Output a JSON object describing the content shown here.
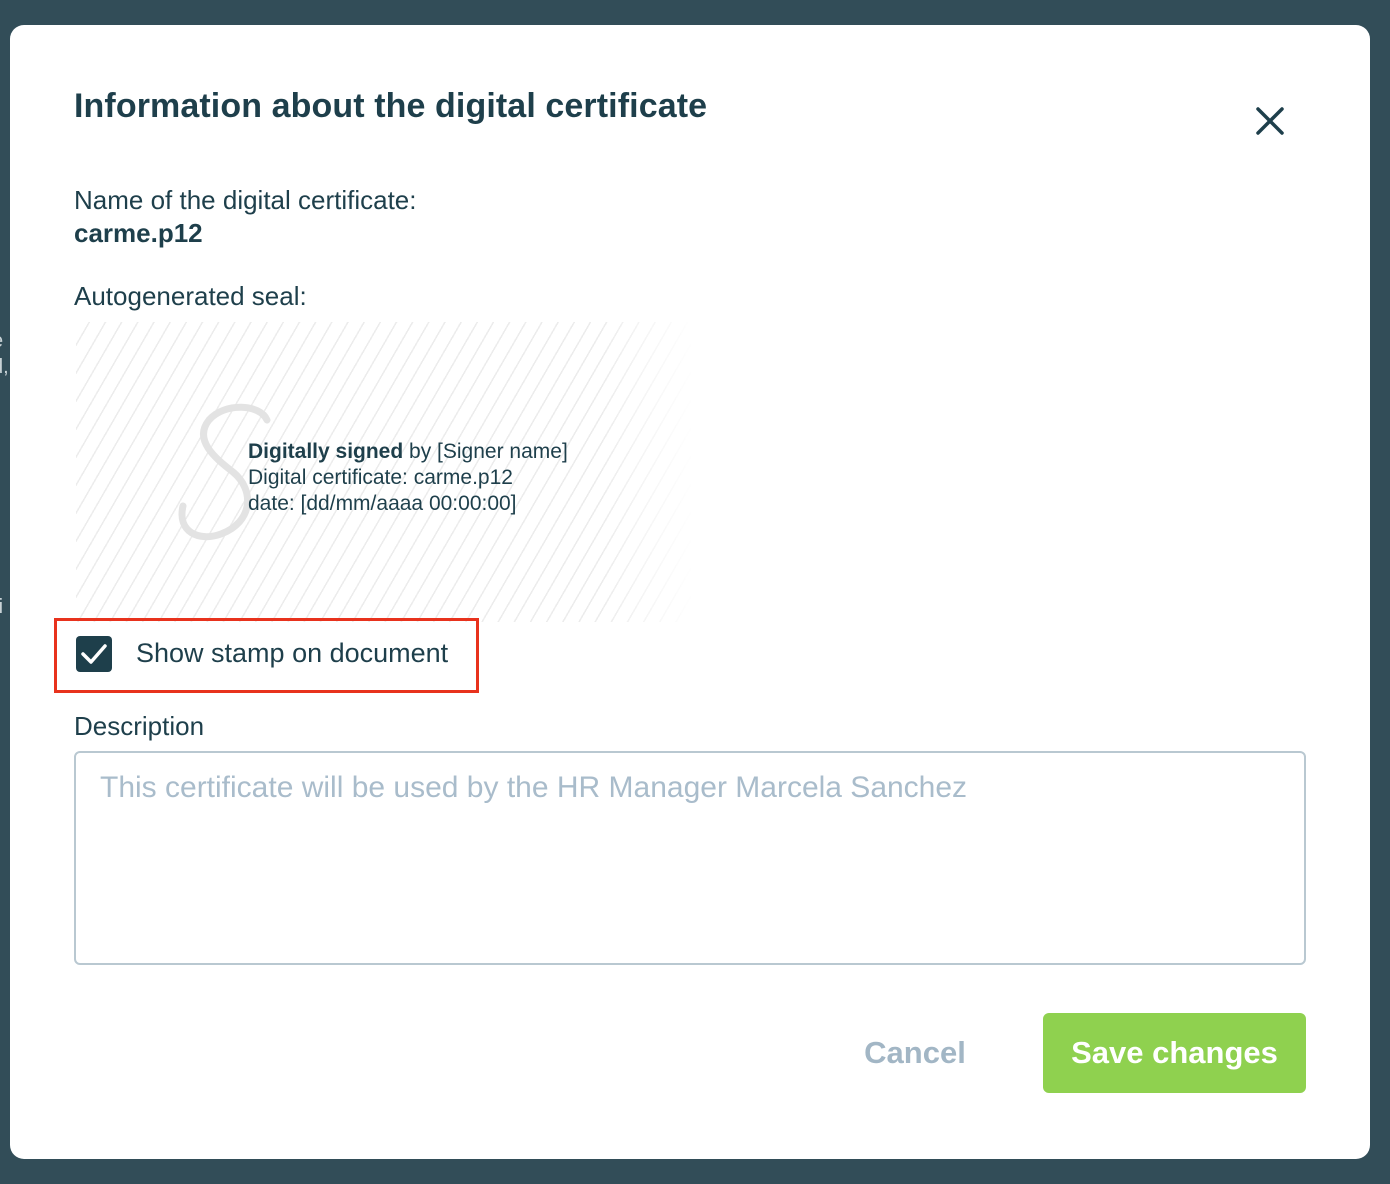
{
  "modal": {
    "title": "Information about the digital certificate",
    "certificate_label": "Name of the digital certificate:",
    "certificate_name": "carme.p12",
    "seal_label": "Autogenerated seal:",
    "seal": {
      "signed_bold": "Digitally signed",
      "signed_rest": " by [Signer name]",
      "certificate_line": "Digital certificate: carme.p12",
      "date_line": "date: [dd/mm/aaaa 00:00:00]"
    },
    "show_stamp": {
      "label": "Show stamp on document",
      "checked": true
    },
    "description": {
      "label": "Description",
      "placeholder": "This certificate will be used by the HR Manager Marcela Sanchez",
      "value": ""
    },
    "buttons": {
      "cancel": "Cancel",
      "save": "Save changes"
    }
  },
  "background_fragments": [
    ",",
    "e",
    "d,",
    "ri"
  ],
  "colors": {
    "backdrop": "#324d58",
    "text_primary": "#1e3f4b",
    "save_button": "#8fd14f",
    "cancel_text": "#a2b6c5",
    "highlight": "#e8321d",
    "placeholder": "#a9bccb"
  }
}
